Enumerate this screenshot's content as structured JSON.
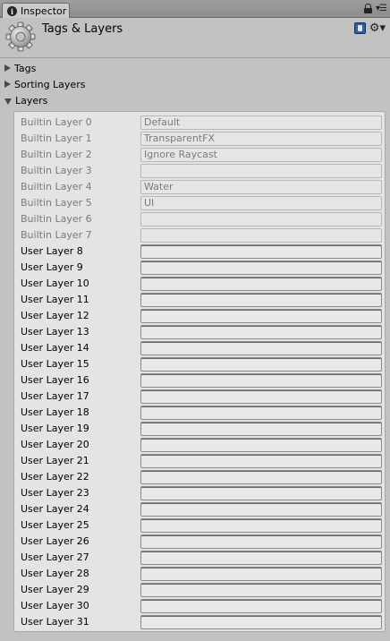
{
  "tab": {
    "label": "Inspector",
    "info_glyph": "i"
  },
  "header": {
    "title": "Tags & Layers"
  },
  "icons": {
    "tab_info": "info-icon",
    "lock": "lock-icon",
    "menu": "menu-icon",
    "header_gear": "gear-icon",
    "help_book": "book-icon",
    "settings": "settings-icon"
  },
  "foldouts": {
    "tags": "Tags",
    "sorting_layers": "Sorting Layers",
    "layers": "Layers"
  },
  "layers": [
    {
      "label": "Builtin Layer 0",
      "value": "Default",
      "builtin": true
    },
    {
      "label": "Builtin Layer 1",
      "value": "TransparentFX",
      "builtin": true
    },
    {
      "label": "Builtin Layer 2",
      "value": "Ignore Raycast",
      "builtin": true
    },
    {
      "label": "Builtin Layer 3",
      "value": "",
      "builtin": true
    },
    {
      "label": "Builtin Layer 4",
      "value": "Water",
      "builtin": true
    },
    {
      "label": "Builtin Layer 5",
      "value": "UI",
      "builtin": true
    },
    {
      "label": "Builtin Layer 6",
      "value": "",
      "builtin": true
    },
    {
      "label": "Builtin Layer 7",
      "value": "",
      "builtin": true
    },
    {
      "label": "User Layer 8",
      "value": "",
      "builtin": false
    },
    {
      "label": "User Layer 9",
      "value": "",
      "builtin": false
    },
    {
      "label": "User Layer 10",
      "value": "",
      "builtin": false
    },
    {
      "label": "User Layer 11",
      "value": "",
      "builtin": false
    },
    {
      "label": "User Layer 12",
      "value": "",
      "builtin": false
    },
    {
      "label": "User Layer 13",
      "value": "",
      "builtin": false
    },
    {
      "label": "User Layer 14",
      "value": "",
      "builtin": false
    },
    {
      "label": "User Layer 15",
      "value": "",
      "builtin": false
    },
    {
      "label": "User Layer 16",
      "value": "",
      "builtin": false
    },
    {
      "label": "User Layer 17",
      "value": "",
      "builtin": false
    },
    {
      "label": "User Layer 18",
      "value": "",
      "builtin": false
    },
    {
      "label": "User Layer 19",
      "value": "",
      "builtin": false
    },
    {
      "label": "User Layer 20",
      "value": "",
      "builtin": false
    },
    {
      "label": "User Layer 21",
      "value": "",
      "builtin": false
    },
    {
      "label": "User Layer 22",
      "value": "",
      "builtin": false
    },
    {
      "label": "User Layer 23",
      "value": "",
      "builtin": false
    },
    {
      "label": "User Layer 24",
      "value": "",
      "builtin": false
    },
    {
      "label": "User Layer 25",
      "value": "",
      "builtin": false
    },
    {
      "label": "User Layer 26",
      "value": "",
      "builtin": false
    },
    {
      "label": "User Layer 27",
      "value": "",
      "builtin": false
    },
    {
      "label": "User Layer 28",
      "value": "",
      "builtin": false
    },
    {
      "label": "User Layer 29",
      "value": "",
      "builtin": false
    },
    {
      "label": "User Layer 30",
      "value": "",
      "builtin": false
    },
    {
      "label": "User Layer 31",
      "value": "",
      "builtin": false
    }
  ],
  "colors": {
    "window_bg": "#c2c2c2",
    "panel_bg": "#e4e4e4",
    "builtin_text": "#7a7a7a",
    "user_text": "#000000"
  }
}
